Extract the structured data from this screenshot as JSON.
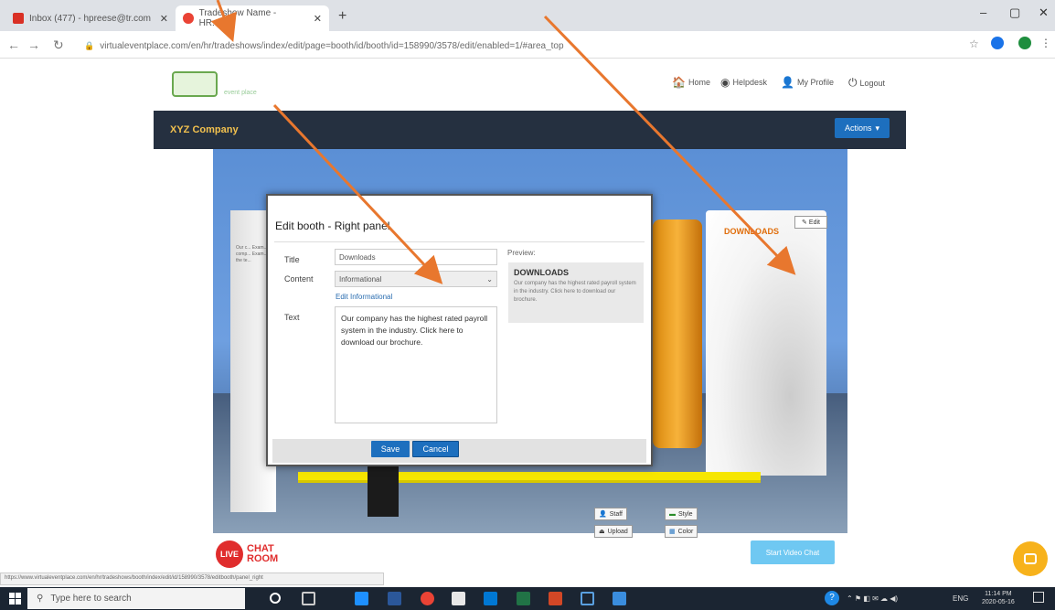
{
  "browser": {
    "tabs": [
      {
        "label": "Inbox (477) - hpreese@tr.com",
        "active": false,
        "favicon_color": "#d93025"
      },
      {
        "label": "Tradeshow Name - HR.com",
        "active": true,
        "favicon_color": "#ea4335"
      }
    ],
    "new_tab": "+",
    "url": "virtualeventplace.com/en/hr/tradeshows/index/edit/page=booth/id/booth/id=158990/3578/edit/enabled=1/#area_top",
    "window_controls": [
      "–",
      "▢",
      "✕"
    ]
  },
  "site": {
    "logo_subtext": "event place",
    "nav": [
      {
        "icon": "home-icon",
        "glyph": "🏠",
        "label": "Home"
      },
      {
        "icon": "helpdesk-icon",
        "glyph": "◉",
        "label": "Helpdesk"
      },
      {
        "icon": "user-icon",
        "glyph": "👤",
        "label": "My Profile"
      },
      {
        "icon": "logout-icon",
        "glyph": "⏻",
        "label": "Logout"
      }
    ],
    "company_name": "XYZ Company",
    "actions_label": "Actions",
    "accent": "#1d6fbe",
    "company_bar_color": "#253040"
  },
  "booth": {
    "right_panel_label": "DOWNLOADS",
    "edit_label": "Edit",
    "left_panel_text": "Our c... Exam... comp... Exam... the te...",
    "scene_buttons": {
      "staff": "Staff",
      "upload": "Upload",
      "style": "Style",
      "color": "Color"
    }
  },
  "modal": {
    "title": "Edit booth - Right panel",
    "title_label": "Title",
    "title_value": "Downloads",
    "content_label": "Content",
    "content_value": "Informational",
    "edit_link": "Edit Informational",
    "text_label": "Text",
    "text_value": "Our company has the highest rated payroll system in the industry. Click here to download our brochure.",
    "preview_label": "Preview:",
    "preview_title": "DOWNLOADS",
    "preview_text": "Our company has the highest rated payroll system in the industry. Click here to download our brochure.",
    "save_label": "Save",
    "cancel_label": "Cancel"
  },
  "chat": {
    "live_label": "LIVE",
    "chat_label": "CHAT",
    "room_label": "ROOM",
    "video_chat_label": "Start Video Chat"
  },
  "statusbar_text": "https://www.virtualeventplace.com/en/hr/tradeshows/booth/index/edit/id/158990/3578/editbooth/panel_right",
  "taskbar": {
    "search_placeholder": "Type here to search",
    "language": "ENG",
    "time": "11:14 PM",
    "date": "2020-05-16"
  }
}
